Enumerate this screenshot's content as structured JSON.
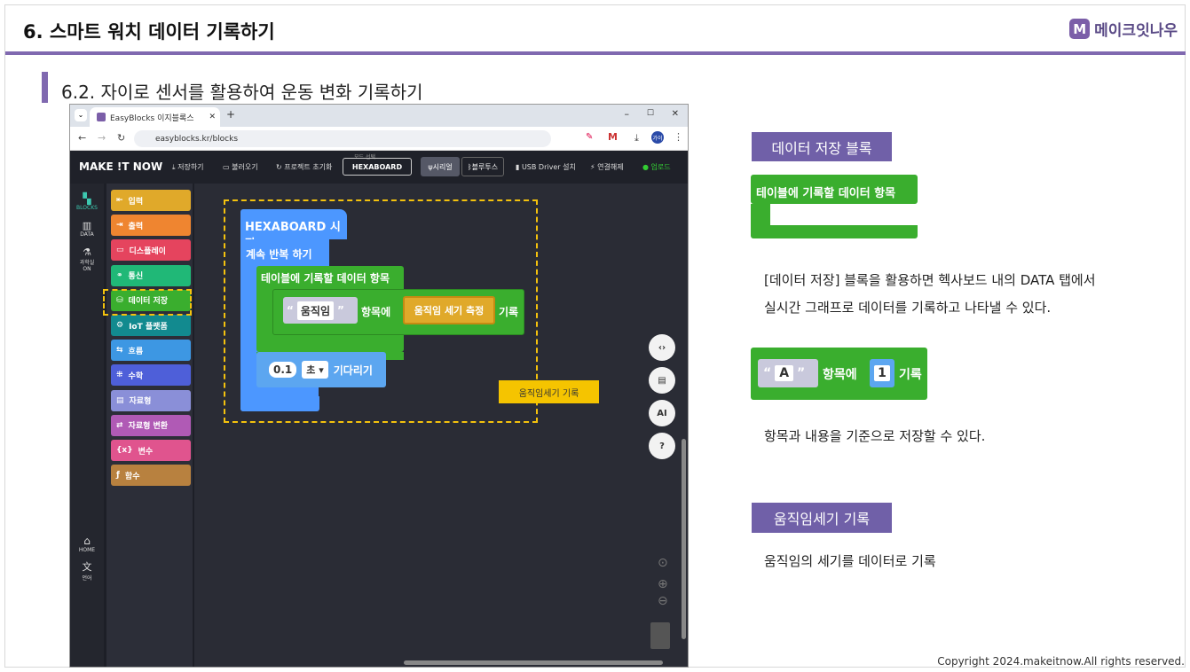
{
  "slide": {
    "title": "6. 스마트 워치 데이터 기록하기",
    "subtitle": "6.2. 자이로 센서를 활용하여 운동 변화 기록하기",
    "logo_mark": "M",
    "logo_text": "메이크잇나우",
    "copyright": "Copyright 2024.makeitnow.All rights reserved."
  },
  "browser": {
    "tab_title": "EasyBlocks 이지블록스",
    "url": "easyblocks.kr/blocks",
    "profile": "가이"
  },
  "app": {
    "brand": "MAKE !T NOW",
    "save": "저장하기",
    "open": "불러오기",
    "reset": "프로젝트 초기화",
    "mode_caption": "모드 선택",
    "mode": "HEXABOARD",
    "serial": "시리얼",
    "bluetooth": "블루투스",
    "usb": "USB Driver 설치",
    "disconnect": "연결해제",
    "upload": "업로드"
  },
  "sidebar": {
    "blocks": "BLOCKS",
    "data": "DATA",
    "science": "과학실",
    "science_on": "ON",
    "home": "HOME",
    "lang": "언어"
  },
  "categories": [
    {
      "label": "입력",
      "color": "#e0a92a"
    },
    {
      "label": "출력",
      "color": "#ef8530"
    },
    {
      "label": "디스플레이",
      "color": "#e5445e"
    },
    {
      "label": "통신",
      "color": "#20b877"
    },
    {
      "label": "데이터 저장",
      "color": "#3aae2e"
    },
    {
      "label": "IoT 플랫폼",
      "color": "#128a8f"
    },
    {
      "label": "흐름",
      "color": "#3d97e3"
    },
    {
      "label": "수학",
      "color": "#4e5fd9"
    },
    {
      "label": "자료형",
      "color": "#8a8fd8"
    },
    {
      "label": "자료형 변환",
      "color": "#b05ab5"
    },
    {
      "label": "변수",
      "color": "#e0548e"
    },
    {
      "label": "함수",
      "color": "#b8813f"
    }
  ],
  "code": {
    "start": "HEXABOARD 시작",
    "loop": "계속 반복 하기",
    "table": "테이블에 기록할 데이터 항목",
    "key": "움직임",
    "item_word": "항목에",
    "sensor": "움직임 세기 측정",
    "record": "기록",
    "wait_val": "0.1",
    "wait_unit": "초",
    "wait_word": "기다리기",
    "note": "움직임세기 기록"
  },
  "right": {
    "tag1": "데이터 저장 블록",
    "block1": "테이블에 기록할 데이터 항목",
    "desc1_line1": "[데이터 저장] 블록을 활용하면 헥사보드 내의 DATA 탭에서",
    "desc1_line2": "실시간 그래프로 데이터를 기록하고 나타낼 수 있다.",
    "block2_key": "A",
    "block2_item": "항목에",
    "block2_val": "1",
    "block2_record": "기록",
    "desc2": "항목과 내용을 기준으로 저장할 수 있다.",
    "tag2": "움직임세기 기록",
    "desc3": "움직임의 세기를 데이터로 기록"
  }
}
